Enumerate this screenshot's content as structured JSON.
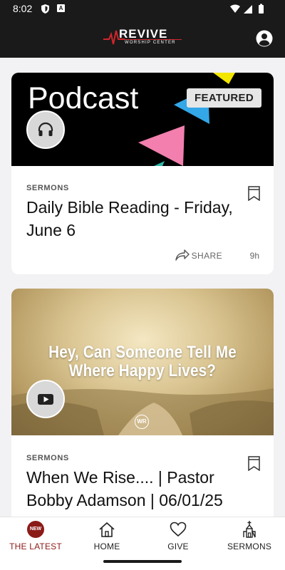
{
  "status_bar": {
    "time": "8:02"
  },
  "header": {
    "logo_text": "REVIVE",
    "logo_subtext": "WORSHIP CENTER",
    "brand_color": "#d0262c"
  },
  "feed": {
    "cards": [
      {
        "image_title": "Podcast",
        "badge": "FEATURED",
        "media_icon": "headphones-icon",
        "category": "SERMONS",
        "title": "Daily Bible Reading - Friday, June 6",
        "share_label": "SHARE",
        "age": "9h"
      },
      {
        "image_title": "Hey, Can Someone Tell Me Where Happy Lives?",
        "image_logo_text": "WR",
        "media_icon": "play-icon",
        "category": "SERMONS",
        "title": "When We Rise.... | Pastor Bobby Adamson | 06/01/25"
      }
    ]
  },
  "bottom_nav": {
    "active_color": "#8b1b17",
    "items": [
      {
        "label": "THE LATEST",
        "badge": "NEW",
        "icon": "new-badge-icon"
      },
      {
        "label": "HOME",
        "icon": "home-icon"
      },
      {
        "label": "GIVE",
        "icon": "heart-icon"
      },
      {
        "label": "SERMONS",
        "icon": "church-icon"
      }
    ]
  }
}
